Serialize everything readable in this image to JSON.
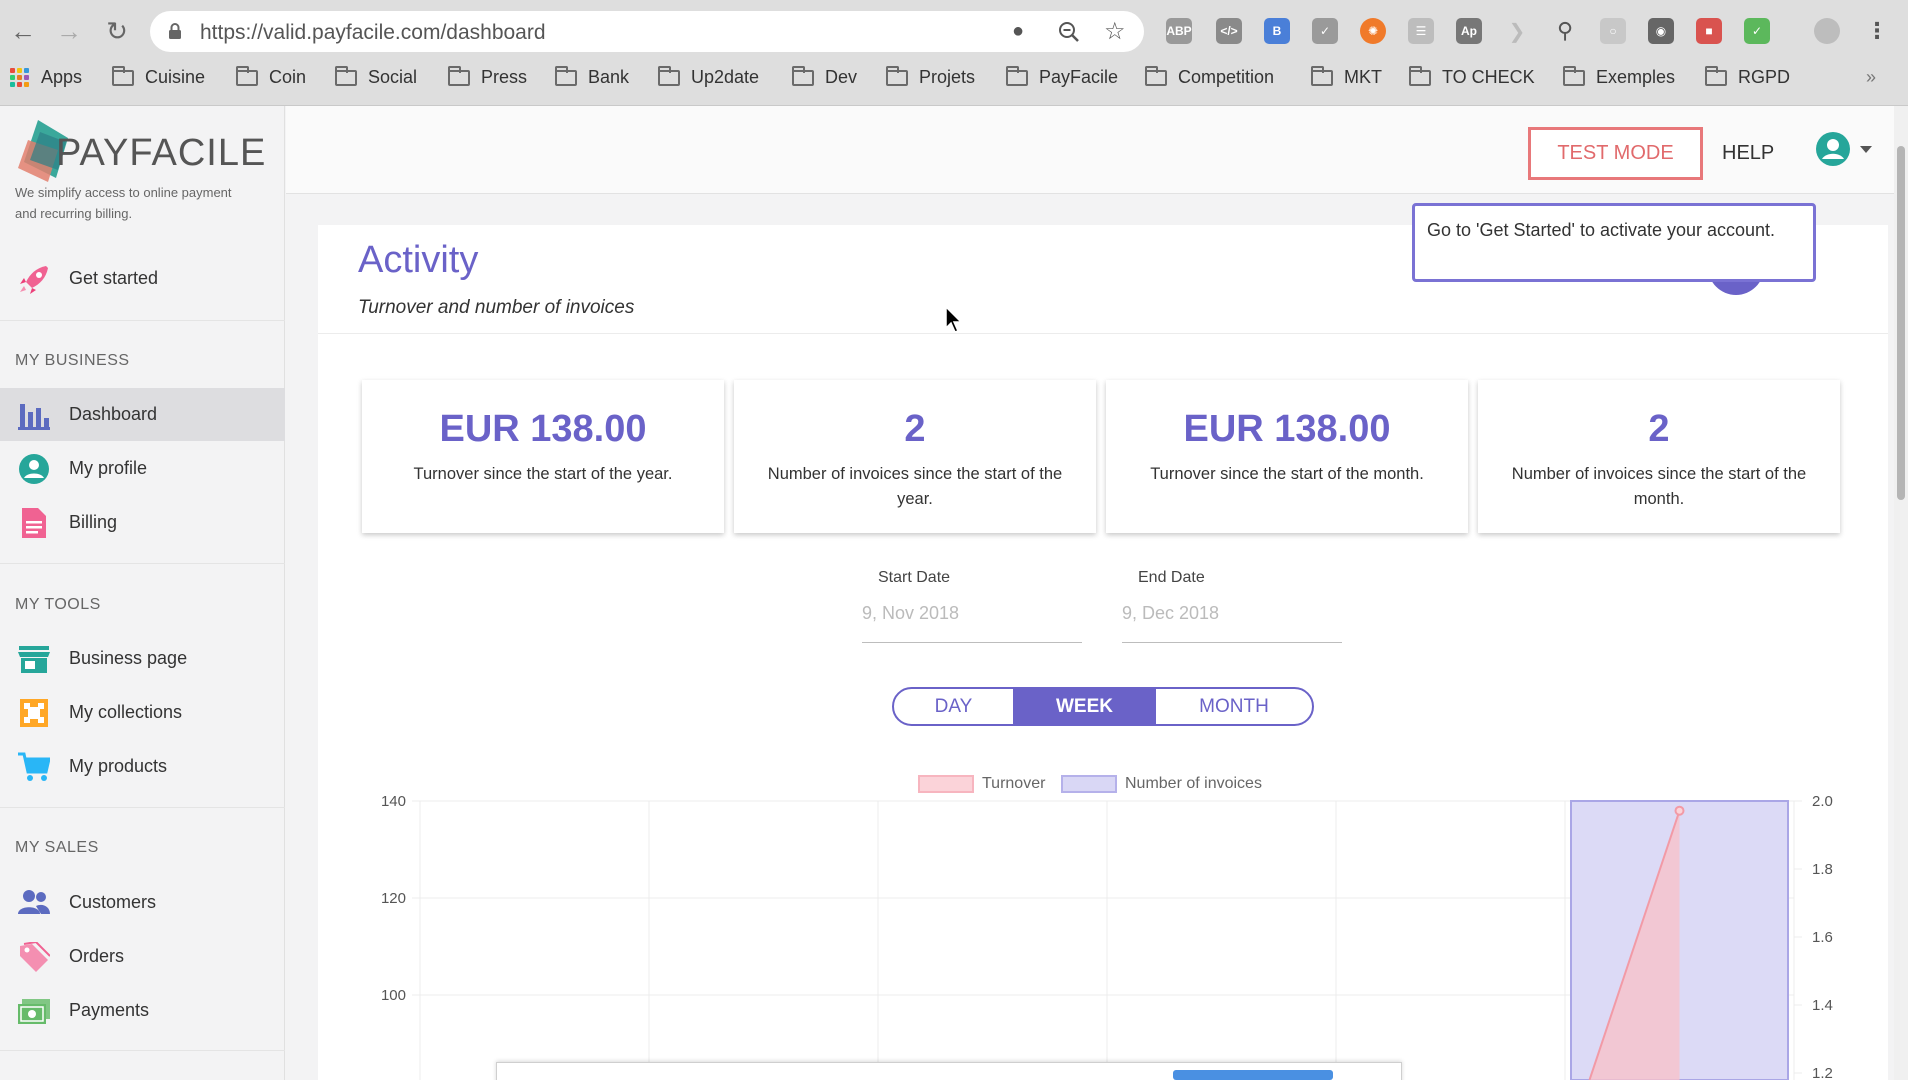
{
  "browser": {
    "url": "https://valid.payfacile.com/dashboard",
    "bookmarks": [
      "Apps",
      "Cuisine",
      "Coin",
      "Social",
      "Press",
      "Bank",
      "Up2date",
      "Dev",
      "Projets",
      "PayFacile",
      "Competition",
      "MKT",
      "TO CHECK",
      "Exemples",
      "RGPD"
    ]
  },
  "brand": {
    "name": "PAYFACILE",
    "tagline": "We simplify access to online payment and recurring billing.",
    "accent": "#6a62c8"
  },
  "sidebar": {
    "get_started": "Get started",
    "sections": {
      "business": "MY BUSINESS",
      "tools": "MY TOOLS",
      "sales": "MY SALES"
    },
    "items": {
      "dashboard": "Dashboard",
      "profile": "My profile",
      "billing": "Billing",
      "business_page": "Business page",
      "collections": "My collections",
      "products": "My products",
      "customers": "Customers",
      "orders": "Orders",
      "payments": "Payments"
    }
  },
  "header": {
    "test_mode": "TEST MODE",
    "help": "HELP"
  },
  "tooltip": "Go to 'Get Started' to activate your account.",
  "activity": {
    "title": "Activity",
    "subtitle": "Turnover and number of invoices"
  },
  "stats": [
    {
      "value": "EUR 138.00",
      "label": "Turnover since the start of the year."
    },
    {
      "value": "2",
      "label": "Number of invoices since the start of the year."
    },
    {
      "value": "EUR 138.00",
      "label": "Turnover since the start of the month."
    },
    {
      "value": "2",
      "label": "Number of invoices since the start of the month."
    }
  ],
  "dates": {
    "start_label": "Start Date",
    "start_value": "9, Nov 2018",
    "end_label": "End Date",
    "end_value": "9, Dec 2018"
  },
  "period": {
    "day": "DAY",
    "week": "WEEK",
    "month": "MONTH",
    "selected": "WEEK"
  },
  "chart_data": {
    "type": "bar",
    "legend": [
      "Turnover",
      "Number of invoices"
    ],
    "legend_placement": "top-center",
    "y_left_ticks": [
      "140",
      "120",
      "100"
    ],
    "y_right_ticks": [
      "2.0",
      "1.8",
      "1.6",
      "1.4",
      "1.2"
    ],
    "y_left_range": [
      0,
      140
    ],
    "y_right_range": [
      0,
      2.0
    ],
    "grid": true,
    "series": [
      {
        "name": "Turnover",
        "type": "line",
        "color": "#f29aa6",
        "values": [
          0,
          0,
          0,
          0,
          0,
          138
        ]
      },
      {
        "name": "Number of invoices",
        "type": "bar",
        "color": "#aaa6e6",
        "values": [
          0,
          0,
          0,
          0,
          0,
          2
        ]
      }
    ]
  }
}
